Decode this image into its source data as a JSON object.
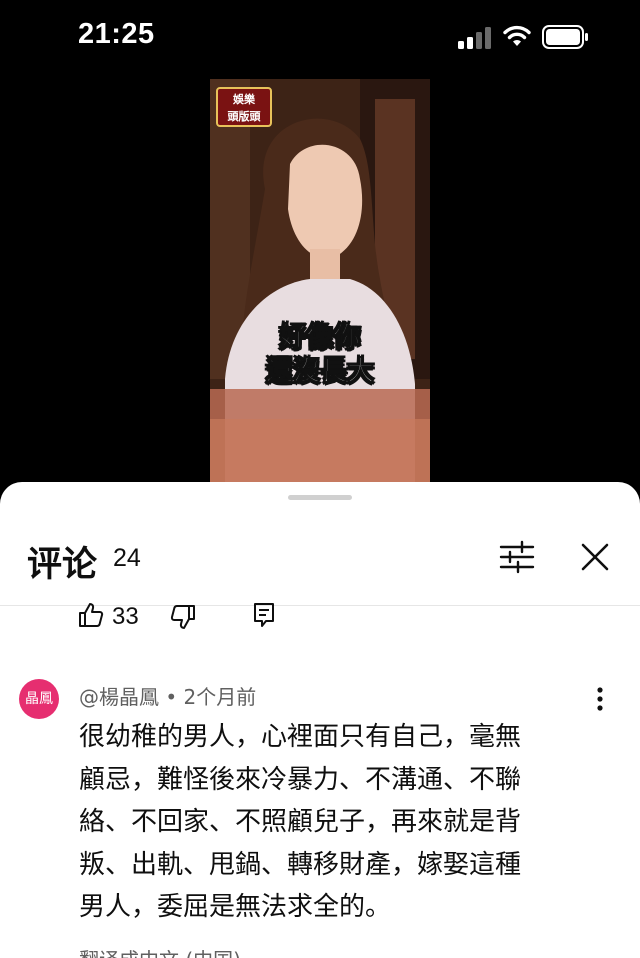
{
  "status_bar": {
    "time": "21:25",
    "icons": [
      "signal-icon",
      "wifi-icon",
      "battery-icon"
    ]
  },
  "video": {
    "logo_lines": [
      "娛樂",
      "頭版頭"
    ],
    "caption_lines": [
      "好像你",
      "還沒長大"
    ]
  },
  "comments": {
    "title": "评论",
    "count": "24",
    "sort_icon": "sliders-icon",
    "close_icon": "close-icon",
    "action_row": {
      "like_count": "33",
      "icons": [
        "thumbs-up-icon",
        "thumbs-down-icon",
        "reply-icon"
      ]
    },
    "comment": {
      "avatar_text": "晶鳳",
      "author": "@楊晶鳳",
      "time": "2个月前",
      "lines": [
        "很幼稚的男人，心裡面只有自己，毫無",
        "顧忌，難怪後來冷暴力、不溝通、不聯",
        "絡、不回家、不照顧兒子，再來就是背",
        "叛、出軌、甩鍋、轉移財產，嫁娶這種",
        "男人，委屈是無法求全的。"
      ],
      "translate_label": "翻译成中文 (中国)"
    }
  },
  "colors": {
    "avatar": "#e62e70",
    "secondary_text": "#606060",
    "background": "#000000",
    "sheet": "#ffffff"
  }
}
